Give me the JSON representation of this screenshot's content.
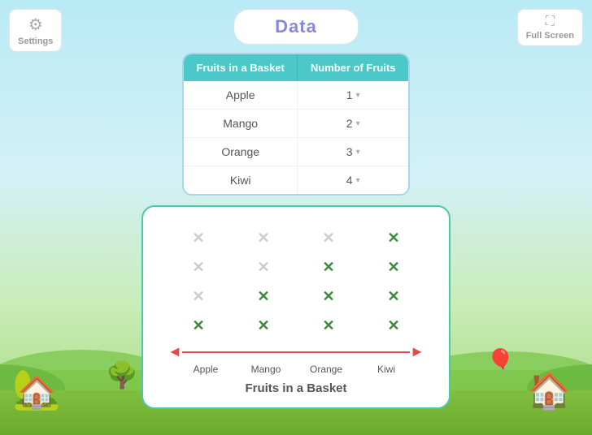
{
  "header": {
    "title": "Data",
    "settings_label": "Settings",
    "fullscreen_label": "Full Screen"
  },
  "table": {
    "col1_header": "Fruits in a Basket",
    "col2_header": "Number of Fruits",
    "rows": [
      {
        "fruit": "Apple",
        "count": 1
      },
      {
        "fruit": "Mango",
        "count": 2
      },
      {
        "fruit": "Orange",
        "count": 3
      },
      {
        "fruit": "Kiwi",
        "count": 4
      }
    ]
  },
  "chart": {
    "title": "Fruits in a Basket",
    "x_labels": [
      "Apple",
      "Mango",
      "Orange",
      "Kiwi"
    ],
    "dot_grid": [
      [
        false,
        false,
        false,
        true
      ],
      [
        false,
        false,
        true,
        true
      ],
      [
        false,
        true,
        true,
        true
      ],
      [
        true,
        true,
        true,
        true
      ]
    ],
    "active_symbol": "✕",
    "inactive_symbol": "✕"
  },
  "icons": {
    "gear": "⚙",
    "fullscreen": "⛶",
    "dropdown": "▾"
  }
}
